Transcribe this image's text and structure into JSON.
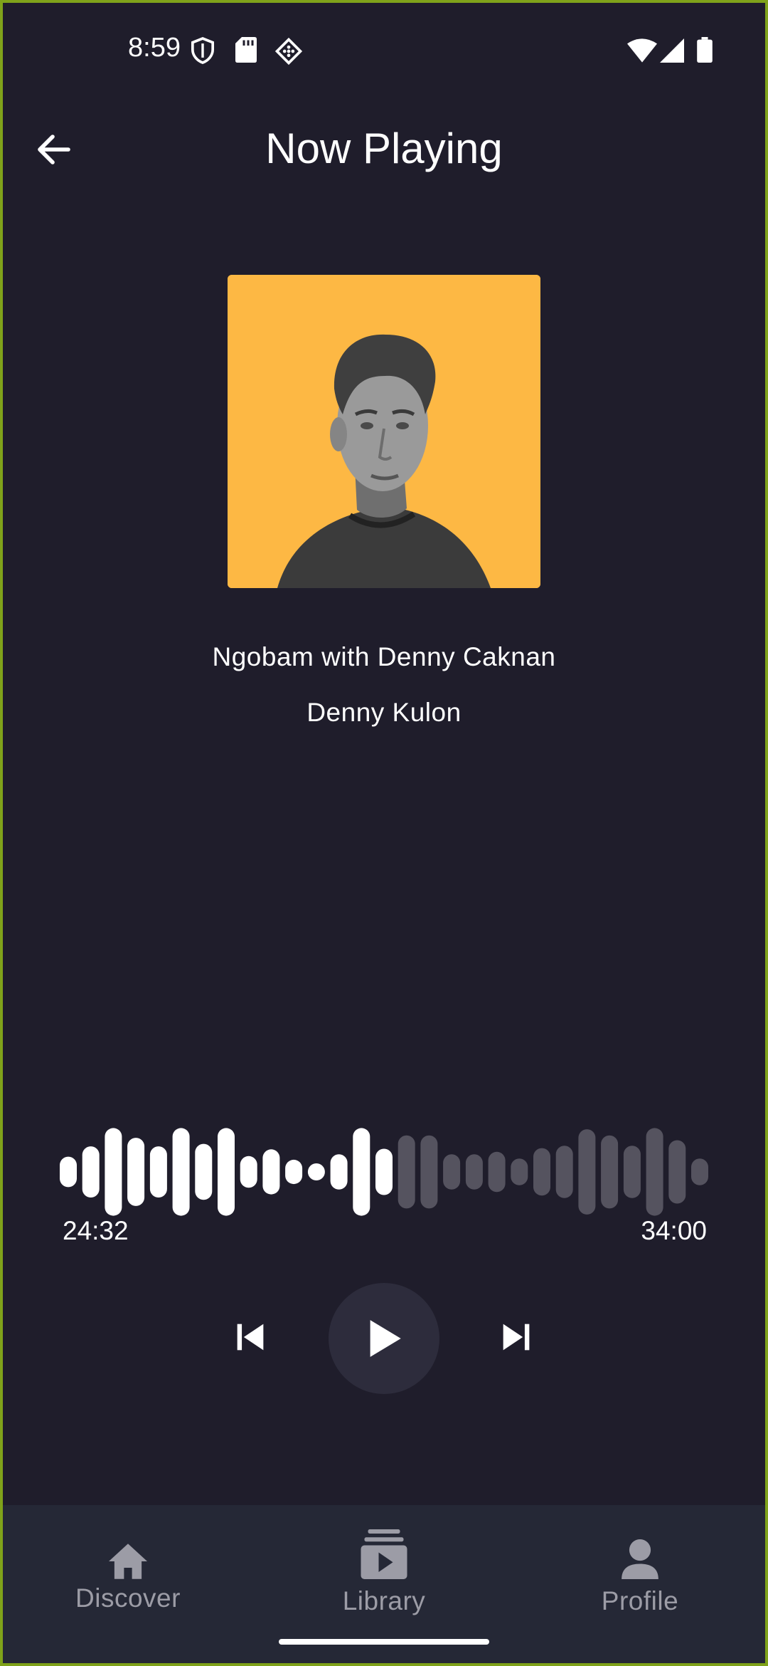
{
  "status_bar": {
    "time": "8:59",
    "icons_left": [
      "shield-icon",
      "sd-card-icon",
      "diamond-grid-icon"
    ],
    "icons_right": [
      "wifi-icon",
      "signal-icon",
      "battery-icon"
    ]
  },
  "header": {
    "title": "Now Playing",
    "back_icon": "arrow-left-icon"
  },
  "track": {
    "title": "Ngobam with Denny Caknan",
    "artist": "Denny Kulon",
    "cover_background": "#fdb844"
  },
  "player": {
    "elapsed": "24:32",
    "duration": "34:00",
    "progress_fraction": 0.5,
    "waveform_levels": [
      0.25,
      0.42,
      0.72,
      0.56,
      0.42,
      0.72,
      0.46,
      0.72,
      0.26,
      0.37,
      0.2,
      0.13,
      0.29,
      0.72,
      0.38,
      0.6,
      0.6,
      0.29,
      0.29,
      0.33,
      0.22,
      0.39,
      0.43,
      0.7,
      0.6,
      0.43,
      0.72,
      0.52,
      0.22
    ],
    "played_color": "#ffffff",
    "unplayed_color": "#55535f",
    "controls": {
      "previous": "skip-previous-icon",
      "play": "play-icon",
      "next": "skip-next-icon"
    }
  },
  "bottom_nav": {
    "items": [
      {
        "label": "Discover",
        "icon": "home-icon"
      },
      {
        "label": "Library",
        "icon": "library-icon"
      },
      {
        "label": "Profile",
        "icon": "person-icon"
      }
    ]
  },
  "colors": {
    "background": "#1f1d2b",
    "nav_background": "#252836",
    "play_button": "#2d2c3c",
    "inactive": "#9c9ca6"
  }
}
